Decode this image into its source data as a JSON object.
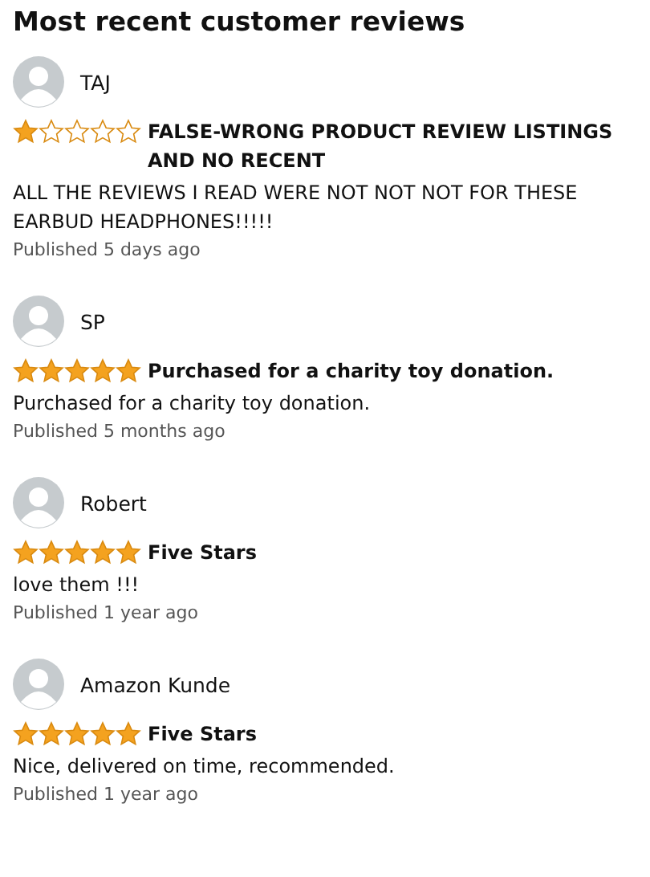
{
  "title": "Most recent customer reviews",
  "reviews": [
    {
      "name": "TAJ",
      "stars": 1,
      "headline": "FALSE-WRONG PRODUCT REVIEW LISTINGS AND NO RECENT",
      "body": "ALL THE REVIEWS I READ WERE NOT NOT NOT FOR THESE EARBUD HEADPHONES!!!!!",
      "published": "Published 5 days ago"
    },
    {
      "name": "SP",
      "stars": 5,
      "headline": "Purchased for a charity toy donation.",
      "body": "Purchased for a charity toy donation.",
      "published": "Published 5 months ago"
    },
    {
      "name": "Robert",
      "stars": 5,
      "headline": "Five Stars",
      "body": "love them !!!",
      "published": "Published 1 year ago"
    },
    {
      "name": "Amazon Kunde",
      "stars": 5,
      "headline": "Five Stars",
      "body": "Nice, delivered on time, recommended.",
      "published": "Published 1 year ago"
    }
  ]
}
